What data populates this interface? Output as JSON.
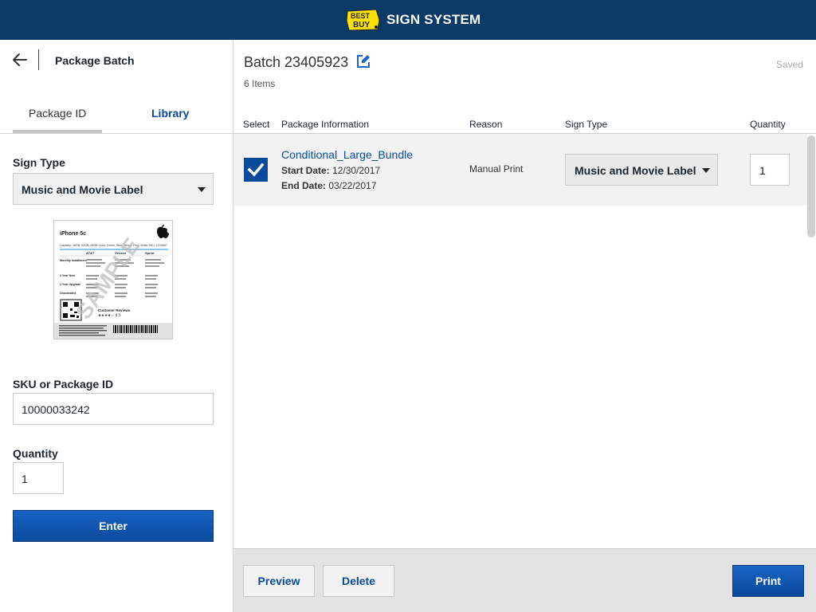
{
  "header": {
    "brand_line1": "BEST",
    "brand_line2": "BUY",
    "app_title": "SIGN SYSTEM",
    "colors": {
      "bar": "#0a3b66",
      "logo_yellow": "#ffe000"
    }
  },
  "left_panel": {
    "title": "Package Batch",
    "tabs": [
      {
        "label": "Package ID",
        "active": true
      },
      {
        "label": "Library",
        "active": false
      }
    ],
    "sign_type": {
      "label": "Sign Type",
      "value": "Music and Movie Label"
    },
    "preview": {
      "heading": "iPhone 5c",
      "capacity_line": "Capacity: 16GB, 32GB, 64GB Color: Green, Blue, Yellow, Pink, White SKU: 1234567",
      "carriers": [
        "AT&T",
        "Verizon",
        "Sprint"
      ],
      "row_labels": [
        "Monthly Installment",
        "2 Year New",
        "2 Year Upgrade",
        "Unactivated"
      ],
      "reviews_label": "Customer Reviews",
      "rating": "★★★★☆ 4.5",
      "watermark": "SAMPLE"
    },
    "sku": {
      "label": "SKU or Package ID",
      "value": "10000033242"
    },
    "quantity": {
      "label": "Quantity",
      "value": "1"
    },
    "enter_label": "Enter"
  },
  "batch": {
    "title": "Batch 23405923",
    "count": "6 Items",
    "status": "Saved",
    "columns": [
      "Select",
      "Package Information",
      "Reason",
      "Sign Type",
      "Quantity"
    ],
    "rows": [
      {
        "name": "Conditional_Large_Bundle",
        "start_label": "Start Date:",
        "start_date": "12/30/2017",
        "end_label": "End Date:",
        "end_date": "03/22/2017",
        "reason": "Manual Print",
        "sign_type": "Music and Movie Label",
        "quantity": "1",
        "selected": true
      }
    ]
  },
  "footer": {
    "preview_label": "Preview",
    "delete_label": "Delete",
    "print_label": "Print"
  },
  "accent_color": "#0a4a9c"
}
